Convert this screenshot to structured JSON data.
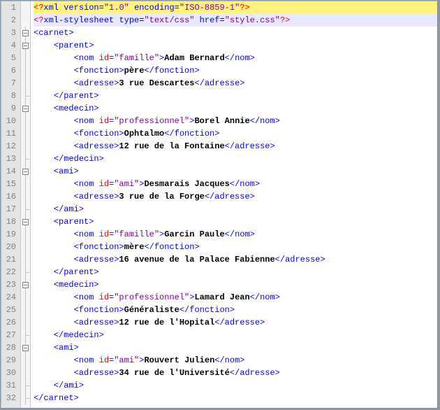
{
  "editor": {
    "lineCount": 32,
    "highlightLines": {
      "1": "hl1",
      "2": "hl2"
    },
    "foldMarks": {
      "3": "box",
      "4": "box",
      "8": "corner",
      "9": "box",
      "13": "corner",
      "14": "box",
      "17": "corner",
      "18": "box",
      "22": "corner",
      "23": "box",
      "27": "corner",
      "28": "box",
      "31": "corner",
      "32": "corner"
    },
    "xml": {
      "declaration": {
        "version": "1.0",
        "encoding": "ISO-8859-1"
      },
      "stylesheet": {
        "type": "text/css",
        "href": "style.css"
      },
      "root": "carnet",
      "entries": [
        {
          "tag": "parent",
          "nomId": "famille",
          "nom": "Adam Bernard",
          "fonction": "père",
          "adresse": "3 rue Descartes"
        },
        {
          "tag": "medecin",
          "nomId": "professionnel",
          "nom": "Borel Annie",
          "fonction": "Ophtalmo",
          "adresse": "12 rue de la Fontaine"
        },
        {
          "tag": "ami",
          "nomId": "ami",
          "nom": "Desmarais Jacques",
          "fonction": null,
          "adresse": "3 rue de la Forge"
        },
        {
          "tag": "parent",
          "nomId": "famille",
          "nom": "Garcin Paule",
          "fonction": "mère",
          "adresse": "16 avenue de la Palace Fabienne"
        },
        {
          "tag": "medecin",
          "nomId": "professionnel",
          "nom": "Lamard Jean",
          "fonction": "Généraliste",
          "adresse": "12 rue de l'Hopital"
        },
        {
          "tag": "ami",
          "nomId": "ami",
          "nom": "Rouvert Julien",
          "fonction": null,
          "adresse": "34 rue de l'Université"
        }
      ]
    }
  }
}
